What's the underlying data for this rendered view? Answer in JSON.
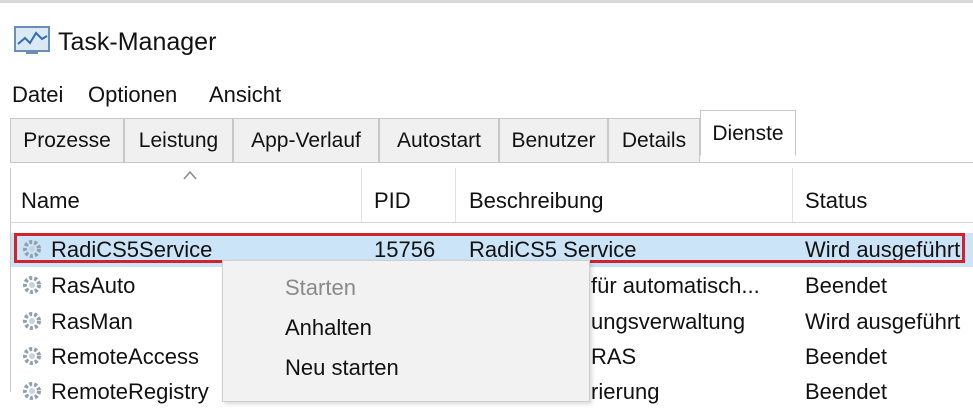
{
  "window": {
    "title": "Task-Manager"
  },
  "menu": [
    "Datei",
    "Optionen",
    "Ansicht"
  ],
  "tabs": [
    "Prozesse",
    "Leistung",
    "App-Verlauf",
    "Autostart",
    "Benutzer",
    "Details",
    "Dienste"
  ],
  "active_tab": "Dienste",
  "columns": {
    "name": "Name",
    "pid": "PID",
    "description": "Beschreibung",
    "status": "Status"
  },
  "rows": [
    {
      "name": "RadiCS5Service",
      "pid": "15756",
      "description": "RadiCS5 Service",
      "status": "Wird ausgeführt",
      "selected": true
    },
    {
      "name": "RasAuto",
      "pid": "",
      "description": "für automatisch...",
      "status": "Beendet"
    },
    {
      "name": "RasMan",
      "pid": "",
      "description": "ungsverwaltung",
      "status": "Wird ausgeführt"
    },
    {
      "name": "RemoteAccess",
      "pid": "",
      "description": "RAS",
      "status": "Beendet"
    },
    {
      "name": "RemoteRegistry",
      "pid": "",
      "description": "rierung",
      "status": "Beendet"
    }
  ],
  "context_menu": [
    {
      "label": "Starten",
      "enabled": false
    },
    {
      "label": "Anhalten",
      "enabled": true
    },
    {
      "label": "Neu starten",
      "enabled": true
    }
  ],
  "colors": {
    "selection": "#cce4f7",
    "highlight_border": "#d2232a",
    "menu_bg": "#f2f2f2"
  },
  "icons": {
    "app": "task-manager-icon",
    "service": "gear-icon"
  }
}
